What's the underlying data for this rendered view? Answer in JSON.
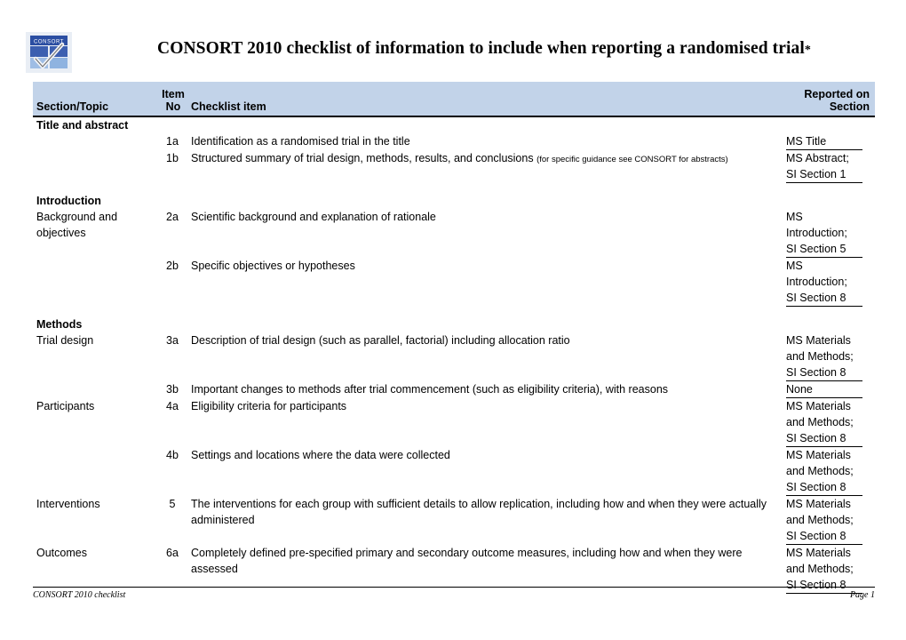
{
  "document": {
    "title": "CONSORT 2010 checklist of information to include when reporting a randomised trial",
    "title_marker": "*",
    "logo_text": "CONSORT",
    "logo_name": "consort-logo"
  },
  "table": {
    "headers": {
      "section_topic": "Section/Topic",
      "item_no_line1": "Item",
      "item_no_line2": "No",
      "checklist_item": "Checklist item",
      "reported_on_line1": "Reported on",
      "reported_on_line2": "Section"
    },
    "header_bg": "#c2d3e9",
    "sections": [
      {
        "heading": "Title and abstract",
        "rows": [
          {
            "topic": "",
            "no": "1a",
            "item": "Identification as a randomised trial in the title",
            "item_fine": "",
            "reported": [
              "MS Title"
            ]
          },
          {
            "topic": "",
            "no": "1b",
            "item": "Structured summary of trial design, methods, results, and conclusions ",
            "item_fine": "(for specific guidance see CONSORT for abstracts)",
            "reported": [
              "MS Abstract;",
              "SI Section 1"
            ]
          }
        ]
      },
      {
        "heading": "Introduction",
        "rows": [
          {
            "topic": "Background and objectives",
            "no": "2a",
            "item": "Scientific background and explanation of rationale",
            "item_fine": "",
            "reported": [
              "MS",
              "Introduction;",
              "SI Section 5"
            ]
          },
          {
            "topic": "",
            "no": "2b",
            "item": "Specific objectives or hypotheses",
            "item_fine": "",
            "reported": [
              "MS",
              "Introduction;",
              "SI Section 8"
            ]
          }
        ]
      },
      {
        "heading": "Methods",
        "rows": [
          {
            "topic": "Trial design",
            "no": "3a",
            "item": "Description of trial design (such as parallel, factorial) including allocation ratio",
            "item_fine": "",
            "reported": [
              "MS Materials",
              "and Methods;",
              "SI Section 8"
            ]
          },
          {
            "topic": "",
            "no": "3b",
            "item": "Important changes to methods after trial commencement (such as eligibility criteria), with reasons",
            "item_fine": "",
            "reported": [
              "None"
            ]
          },
          {
            "topic": "Participants",
            "no": "4a",
            "item": "Eligibility criteria for participants",
            "item_fine": "",
            "reported": [
              "MS Materials",
              "and Methods;",
              "SI Section 8"
            ]
          },
          {
            "topic": "",
            "no": "4b",
            "item": "Settings and locations where the data were collected",
            "item_fine": "",
            "reported": [
              "MS Materials",
              "and Methods;",
              "SI Section 8"
            ]
          },
          {
            "topic": "Interventions",
            "no": "5",
            "item": "The interventions for each group with sufficient details to allow replication, including how and when they were actually administered",
            "item_fine": "",
            "reported": [
              "MS Materials",
              "and Methods;",
              "SI Section 8"
            ]
          },
          {
            "topic": "Outcomes",
            "no": "6a",
            "item": "Completely defined pre-specified primary and secondary outcome measures, including how and when they were assessed",
            "item_fine": "",
            "reported": [
              "MS Materials",
              "and Methods;",
              "SI Section 8"
            ]
          }
        ]
      }
    ]
  },
  "footer": {
    "left": "CONSORT 2010 checklist",
    "right": "Page 1"
  }
}
